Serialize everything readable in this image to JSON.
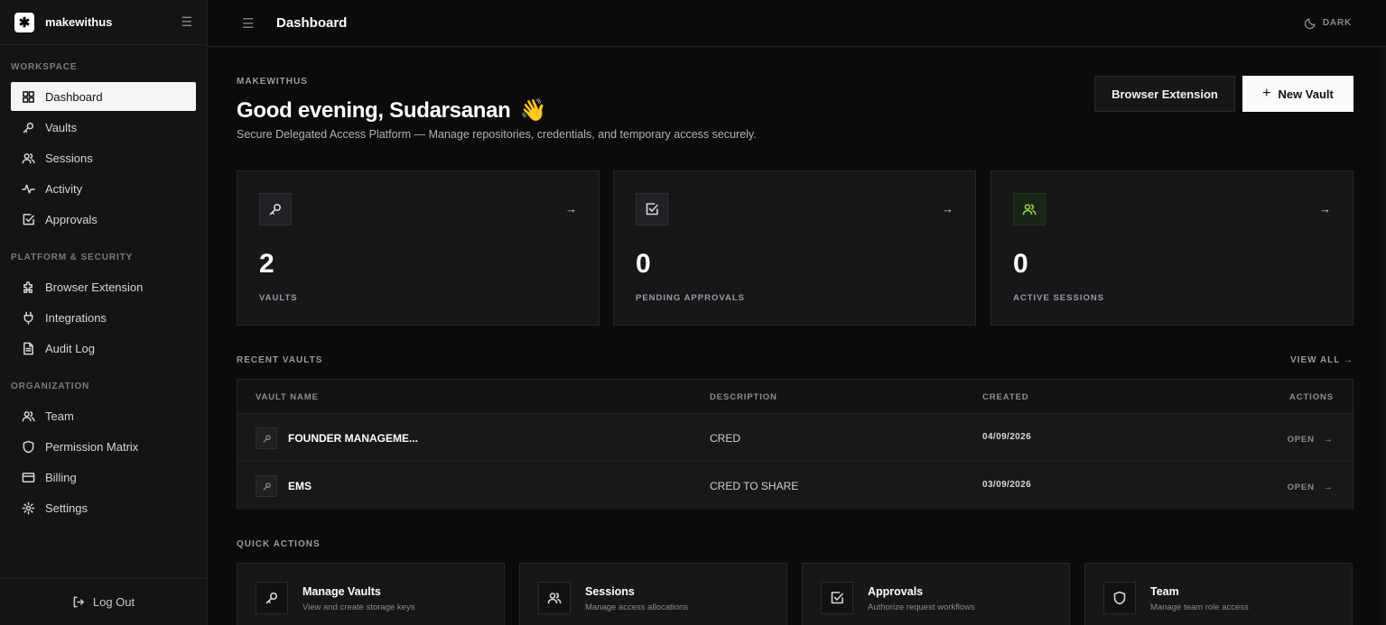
{
  "sidebar": {
    "brand": "makewithus",
    "sections": [
      {
        "label": "WORKSPACE",
        "items": [
          "Dashboard",
          "Vaults",
          "Sessions",
          "Activity",
          "Approvals"
        ]
      },
      {
        "label": "PLATFORM & SECURITY",
        "items": [
          "Browser Extension",
          "Integrations",
          "Audit Log"
        ]
      },
      {
        "label": "ORGANIZATION",
        "items": [
          "Team",
          "Permission Matrix",
          "Billing",
          "Settings"
        ]
      }
    ],
    "logout": "Log Out"
  },
  "topbar": {
    "title": "Dashboard",
    "theme": "DARK"
  },
  "header": {
    "org": "MAKEWITHUS",
    "greeting": "Good evening, Sudarsanan",
    "emoji": "👋",
    "subtitle": "Secure Delegated Access Platform — Manage repositories, credentials, and temporary access securely.",
    "browser_extension": "Browser Extension",
    "new_vault": "New Vault"
  },
  "stats": [
    {
      "value": "2",
      "label": "VAULTS",
      "icon": "key-icon"
    },
    {
      "value": "0",
      "label": "PENDING APPROVALS",
      "icon": "check-square-icon"
    },
    {
      "value": "0",
      "label": "ACTIVE SESSIONS",
      "icon": "users-icon",
      "accent": "#8bd13f"
    }
  ],
  "recent": {
    "heading": "RECENT VAULTS",
    "view_all": "VIEW ALL →",
    "columns": [
      "VAULT NAME",
      "DESCRIPTION",
      "CREATED",
      "ACTIONS"
    ],
    "rows": [
      {
        "name": "FOUNDER MANAGEME...",
        "description": "CRED",
        "created": "04/09/2026",
        "action": "OPEN"
      },
      {
        "name": "EMS",
        "description": "CRED TO SHARE",
        "created": "03/09/2026",
        "action": "OPEN"
      }
    ]
  },
  "quick": {
    "heading": "QUICK ACTIONS",
    "items": [
      {
        "title": "Manage Vaults",
        "desc": "View and create storage keys"
      },
      {
        "title": "Sessions",
        "desc": "Manage access allocations"
      },
      {
        "title": "Approvals",
        "desc": "Authorize request workflows"
      },
      {
        "title": "Team",
        "desc": "Manage team role access"
      }
    ]
  }
}
